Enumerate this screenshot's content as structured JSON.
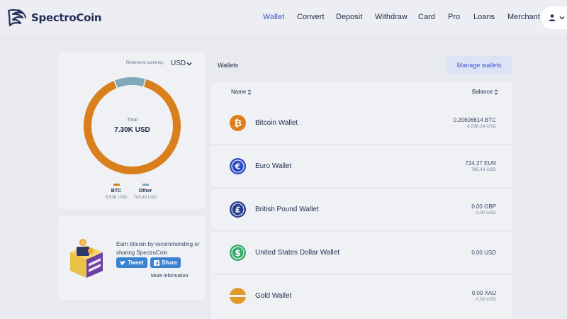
{
  "brand": {
    "name": "SpectroCoin"
  },
  "nav": {
    "items": [
      {
        "label": "Wallet",
        "active": true
      },
      {
        "label": "Convert"
      },
      {
        "label": "Deposit"
      },
      {
        "label": "Withdraw"
      },
      {
        "label": "Card"
      },
      {
        "label": "Pro"
      },
      {
        "label": "Loans"
      },
      {
        "label": "Merchant"
      }
    ]
  },
  "user_menu": {
    "icon": "user-icon"
  },
  "portfolio": {
    "reference_label": "Reference currency:",
    "reference_value": "USD",
    "total_label": "Total",
    "total_value": "7.30K USD",
    "segments": [
      {
        "name": "BTC",
        "value": "6.53K USD",
        "amount": 6536.24,
        "color": "#d9801d"
      },
      {
        "name": "Other",
        "value": "765.43 USD",
        "amount": 765.43,
        "color": "#7fa8bb"
      }
    ]
  },
  "promo": {
    "text": "Earn bitcoin by recommending or sharing SpectroCoin",
    "tweet_label": "Tweet",
    "share_label": "Share",
    "more_label": "More information"
  },
  "wallets": {
    "title": "Wallets",
    "manage_label": "Manage wallets",
    "col_name": "Name",
    "col_balance": "Balance",
    "rows": [
      {
        "name": "Bitcoin Wallet",
        "balance": "0.20606614 BTC",
        "balance_usd": "6,536.24 USD",
        "icon": "bitcoin-icon",
        "color": "#e07f1a"
      },
      {
        "name": "Euro Wallet",
        "balance": "724.27 EUR",
        "balance_usd": "765.43 USD",
        "icon": "euro-icon",
        "color": "#2d4ec2"
      },
      {
        "name": "British Pound Wallet",
        "balance": "0.00 GBP",
        "balance_usd": "0.00 USD",
        "icon": "pound-icon",
        "color": "#2a3e8f"
      },
      {
        "name": "United States Dollar Wallet",
        "balance": "0.00 USD",
        "balance_usd": "",
        "icon": "dollar-icon",
        "color": "#3aaa6e"
      },
      {
        "name": "Gold Wallet",
        "balance": "0.00 XAU",
        "balance_usd": "0.00 USD",
        "icon": "gold-icon",
        "color": "#e39a2c"
      }
    ]
  }
}
